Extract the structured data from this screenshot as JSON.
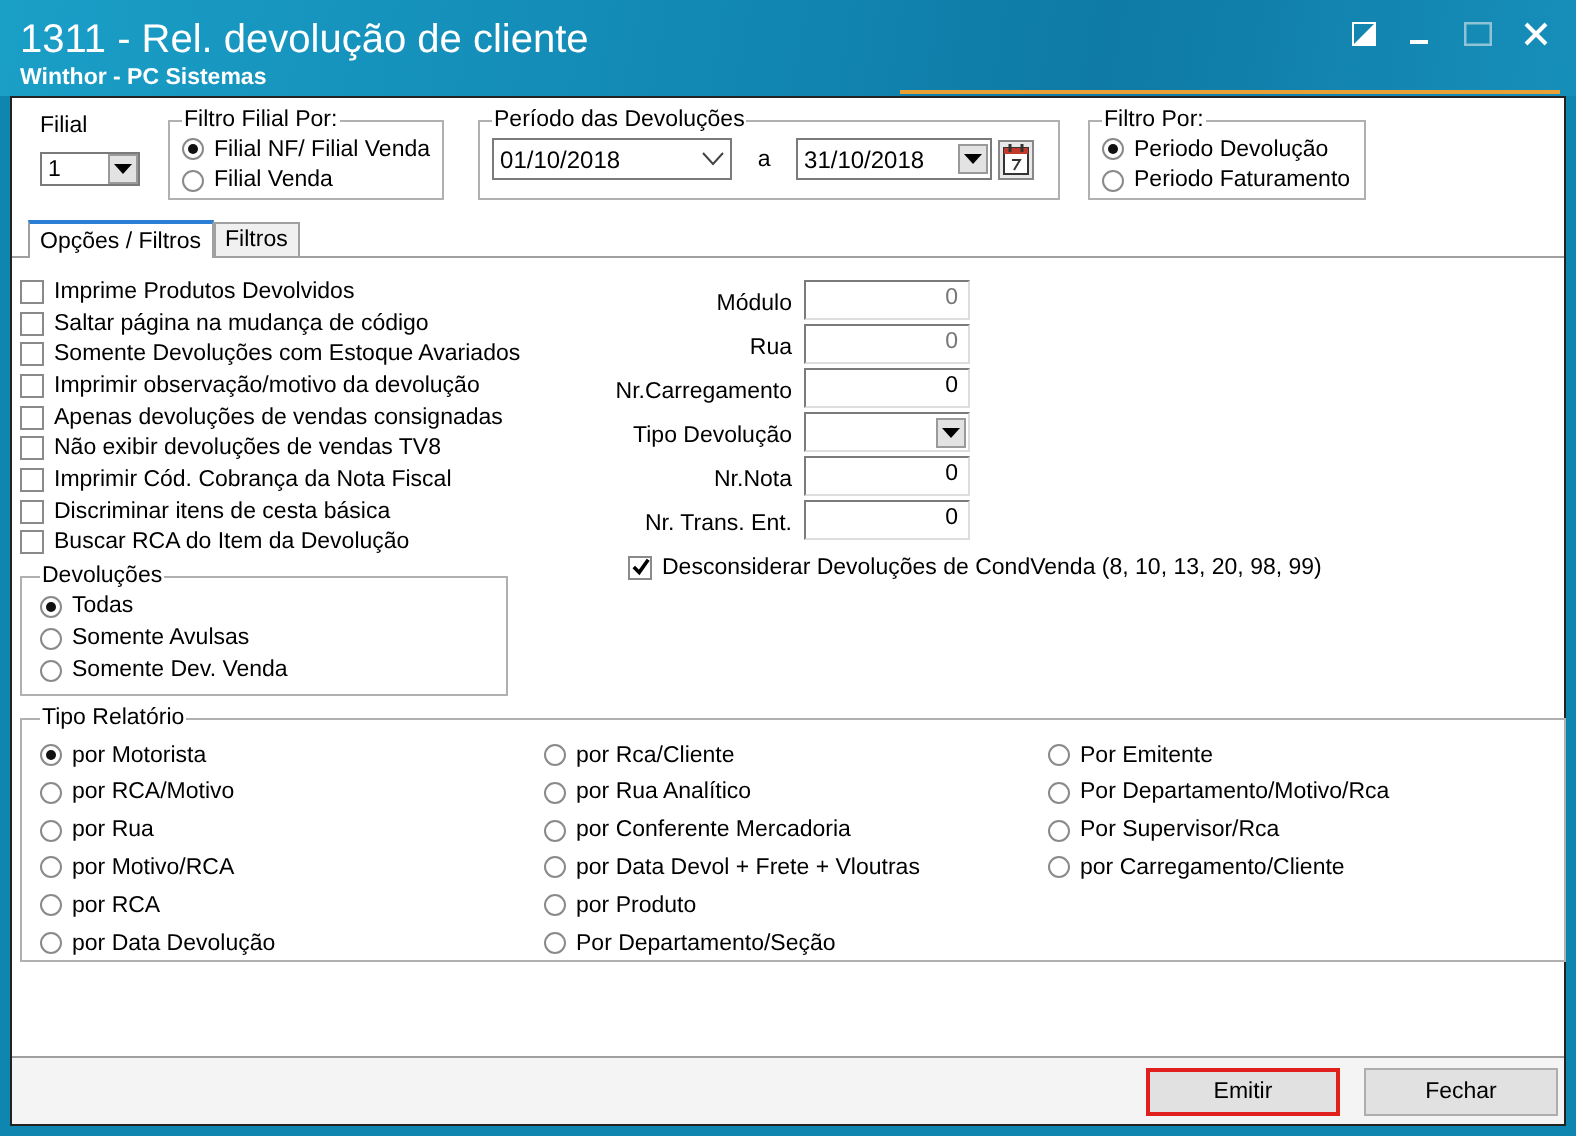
{
  "window": {
    "title": "1311 - Rel. devolução de cliente",
    "subtitle": "Winthor - PC Sistemas"
  },
  "filial": {
    "label": "Filial",
    "value": "1"
  },
  "filtro_filial": {
    "title": "Filtro Filial Por:",
    "options": [
      {
        "label": "Filial NF/ Filial Venda",
        "selected": true
      },
      {
        "label": "Filial Venda",
        "selected": false
      }
    ]
  },
  "periodo": {
    "title": "Período das Devoluções",
    "start": "01/10/2018",
    "separator": "a",
    "end": "31/10/2018"
  },
  "filtro_por": {
    "title": "Filtro Por:",
    "options": [
      {
        "label": "Periodo Devolução",
        "selected": true
      },
      {
        "label": "Periodo Faturamento",
        "selected": false
      }
    ]
  },
  "tabs": [
    {
      "label": "Opções / Filtros",
      "selected": true
    },
    {
      "label": "Filtros",
      "selected": false
    }
  ],
  "options": [
    {
      "label": "Imprime Produtos Devolvidos",
      "checked": false
    },
    {
      "label": "Saltar página na mudança de código",
      "checked": false
    },
    {
      "label": "Somente Devoluções com Estoque Avariados",
      "checked": false
    },
    {
      "label": "Imprimir observação/motivo da devolução",
      "checked": false
    },
    {
      "label": "Apenas devoluções de vendas consignadas",
      "checked": false
    },
    {
      "label": "Não exibir devoluções de vendas TV8",
      "checked": false
    },
    {
      "label": "Imprimir Cód. Cobrança da Nota Fiscal",
      "checked": false
    },
    {
      "label": "Discriminar itens de cesta básica",
      "checked": false
    },
    {
      "label": "Buscar RCA do Item da Devolução",
      "checked": false
    }
  ],
  "fields": [
    {
      "label": "Módulo",
      "kind": "number",
      "value": "0",
      "disabled": true
    },
    {
      "label": "Rua",
      "kind": "number",
      "value": "0",
      "disabled": true
    },
    {
      "label": "Nr.Carregamento",
      "kind": "number",
      "value": "0",
      "disabled": false
    },
    {
      "label": "Tipo Devolução",
      "kind": "dropdown",
      "disabled": false
    },
    {
      "label": "Nr.Nota",
      "kind": "number",
      "value": "0",
      "disabled": false
    },
    {
      "label": "Nr. Trans. Ent.",
      "kind": "number",
      "value": "0",
      "disabled": false
    }
  ],
  "desconsiderar": {
    "label": "Desconsiderar  Devoluções de CondVenda (8, 10, 13, 20, 98, 99)",
    "checked": true
  },
  "devolucoes": {
    "title": "Devoluções",
    "options": [
      {
        "label": "Todas",
        "selected": true
      },
      {
        "label": "Somente Avulsas",
        "selected": false
      },
      {
        "label": "Somente Dev. Venda",
        "selected": false
      }
    ]
  },
  "tipo_relatorio": {
    "title": "Tipo Relatório",
    "columns": [
      {
        "options": [
          {
            "label": "por Motorista",
            "selected": true
          },
          {
            "label": "por RCA/Motivo",
            "selected": false
          },
          {
            "label": "por Rua",
            "selected": false
          },
          {
            "label": "por Motivo/RCA",
            "selected": false
          },
          {
            "label": "por RCA",
            "selected": false
          },
          {
            "label": "por Data Devolução",
            "selected": false
          }
        ]
      },
      {
        "options": [
          {
            "label": "por Rca/Cliente",
            "selected": false
          },
          {
            "label": "por Rua Analítico",
            "selected": false
          },
          {
            "label": "por Conferente Mercadoria",
            "selected": false
          },
          {
            "label": "por Data Devol + Frete + Vloutras",
            "selected": false
          },
          {
            "label": "por Produto",
            "selected": false
          },
          {
            "label": "Por Departamento/Seção",
            "selected": false
          }
        ]
      },
      {
        "options": [
          {
            "label": "Por Emitente",
            "selected": false
          },
          {
            "label": "Por Departamento/Motivo/Rca",
            "selected": false
          },
          {
            "label": "Por Supervisor/Rca",
            "selected": false
          },
          {
            "label": "por Carregamento/Cliente",
            "selected": false
          }
        ]
      }
    ]
  },
  "buttons": [
    {
      "label": "Emitir",
      "highlighted": true
    },
    {
      "label": "Fechar",
      "highlighted": false
    }
  ]
}
